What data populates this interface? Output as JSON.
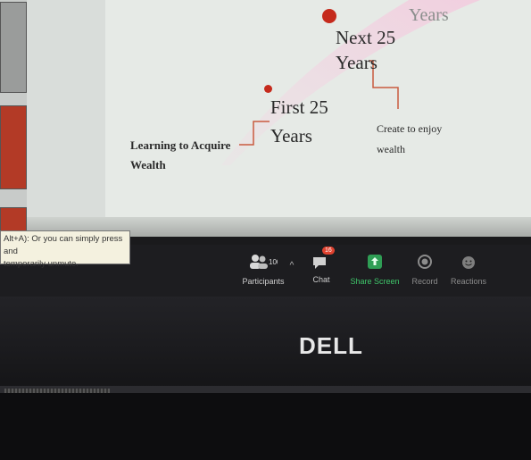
{
  "slide": {
    "stage_top": "Years",
    "stage_next": "Next 25",
    "stage_next_years": "Years",
    "stage_first": "First 25",
    "stage_first_years": "Years",
    "caption_left_line1": "Learning to Acquire",
    "caption_left_line2": "Wealth",
    "caption_right_line1": "Create to enjoy",
    "caption_right_line2": "wealth"
  },
  "tooltip": {
    "line1": "Alt+A): Or you can simply press and",
    "line2": "temporarily unmute."
  },
  "toolbar": {
    "participants_count": "100",
    "participants_label": "Participants",
    "chat_badge": "16",
    "chat_label": "Chat",
    "share_label": "Share Screen",
    "record_label": "Record",
    "reactions_label": "Reactions"
  },
  "monitor": {
    "brand": "DELL"
  },
  "colors": {
    "accent_red": "#c52a1c",
    "share_green": "#3fc66a"
  }
}
